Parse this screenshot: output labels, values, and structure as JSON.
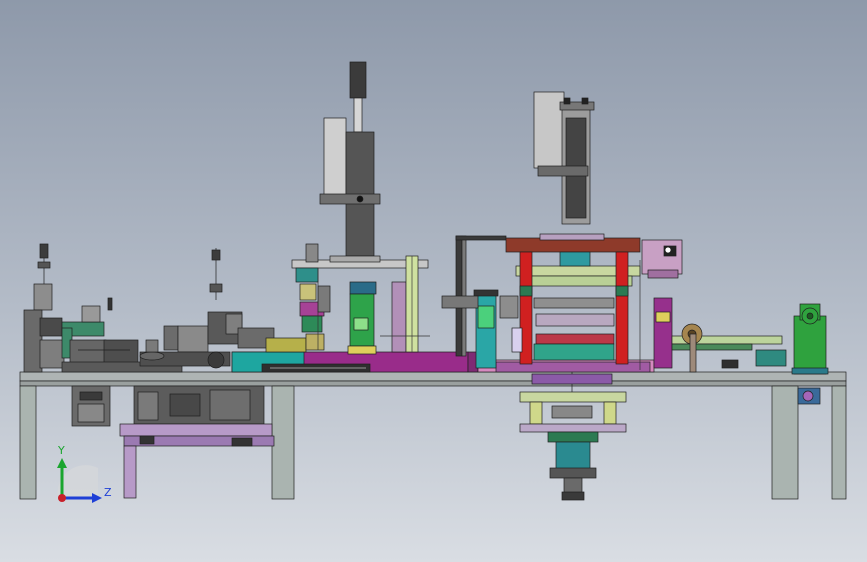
{
  "triad": {
    "y_label": "Y",
    "z_label": "Z",
    "y_color": "#1aa52e",
    "z_color": "#1e3fd6",
    "origin_color": "#c8202a"
  }
}
